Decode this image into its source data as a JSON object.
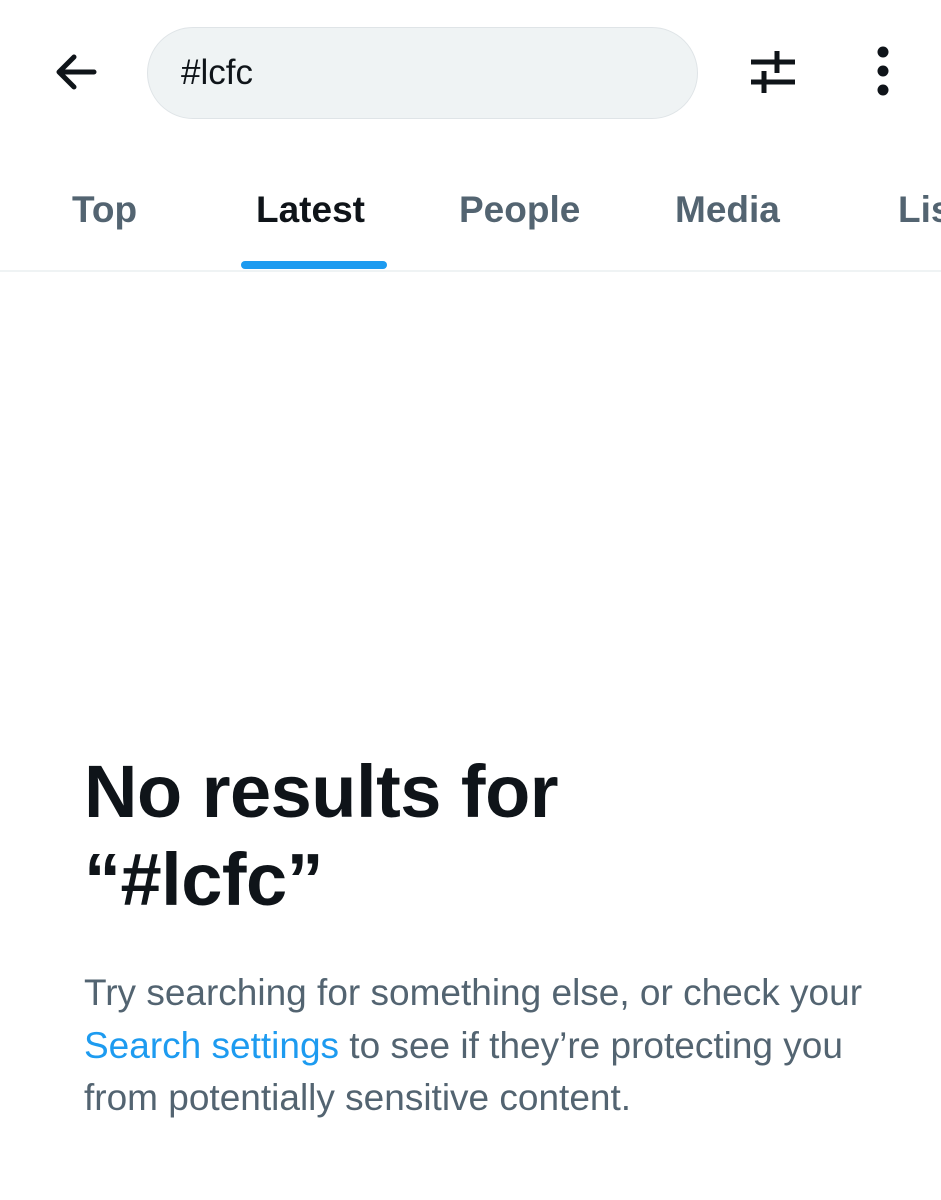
{
  "search": {
    "query": "#lcfc"
  },
  "tabs": [
    {
      "label": "Top"
    },
    {
      "label": "Latest"
    },
    {
      "label": "People"
    },
    {
      "label": "Media"
    },
    {
      "label": "Lists"
    }
  ],
  "empty_state": {
    "title_line1": "No results for",
    "title_line2": "“#lcfc”",
    "desc_before": "Try searching for something else, or check your ",
    "link_label": "Search settings",
    "desc_after": " to see if they’re protecting you from potentially sensitive content."
  },
  "icons": {
    "back": "arrow-left-icon",
    "filter": "sliders-icon",
    "more": "more-vertical-icon"
  },
  "colors": {
    "accent": "#1d9bf0",
    "text_primary": "#0f1419",
    "text_secondary": "#536471",
    "search_bg": "#eff3f4"
  }
}
